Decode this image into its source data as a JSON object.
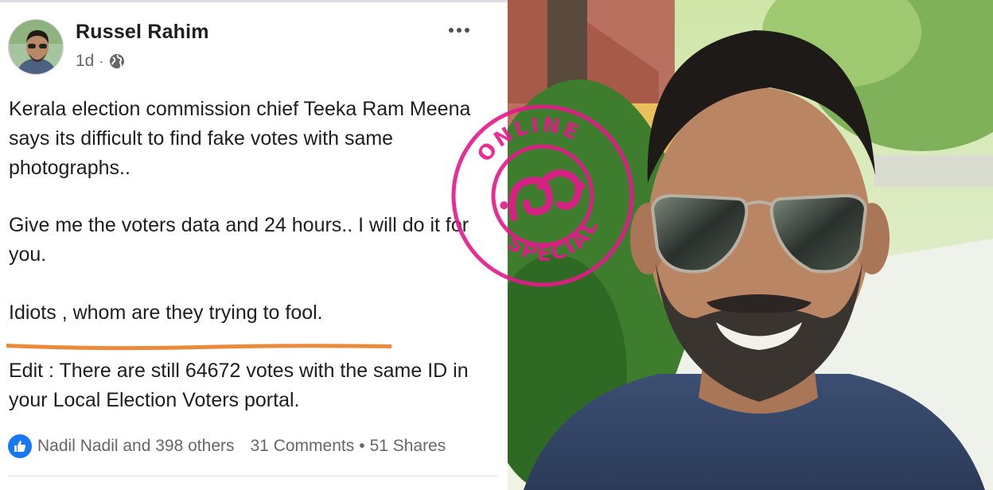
{
  "post": {
    "author": "Russel Rahim",
    "time": "1d",
    "meta_separator": "·",
    "paragraphs": [
      "Kerala election commission chief Teeka Ram Meena says its difficult to find fake votes with same photographs..",
      "Give me the voters data and 24 hours.. I will do it for you.",
      "Idiots , whom are they trying to fool.",
      "Edit : There are still 64672 votes with the same ID in your Local Election Voters portal."
    ],
    "reactions": {
      "names": "Nadil Nadil and 398 others",
      "comments": "31 Comments",
      "separator": "•",
      "shares": "51 Shares"
    }
  },
  "stamp": {
    "top_text": "ONLINE",
    "bottom_text": "SPECIAL",
    "color": "#e5188c"
  },
  "colors": {
    "facebook_blue": "#1877f2",
    "underline_orange": "#ea8a3c",
    "text_gray": "#65676b"
  }
}
